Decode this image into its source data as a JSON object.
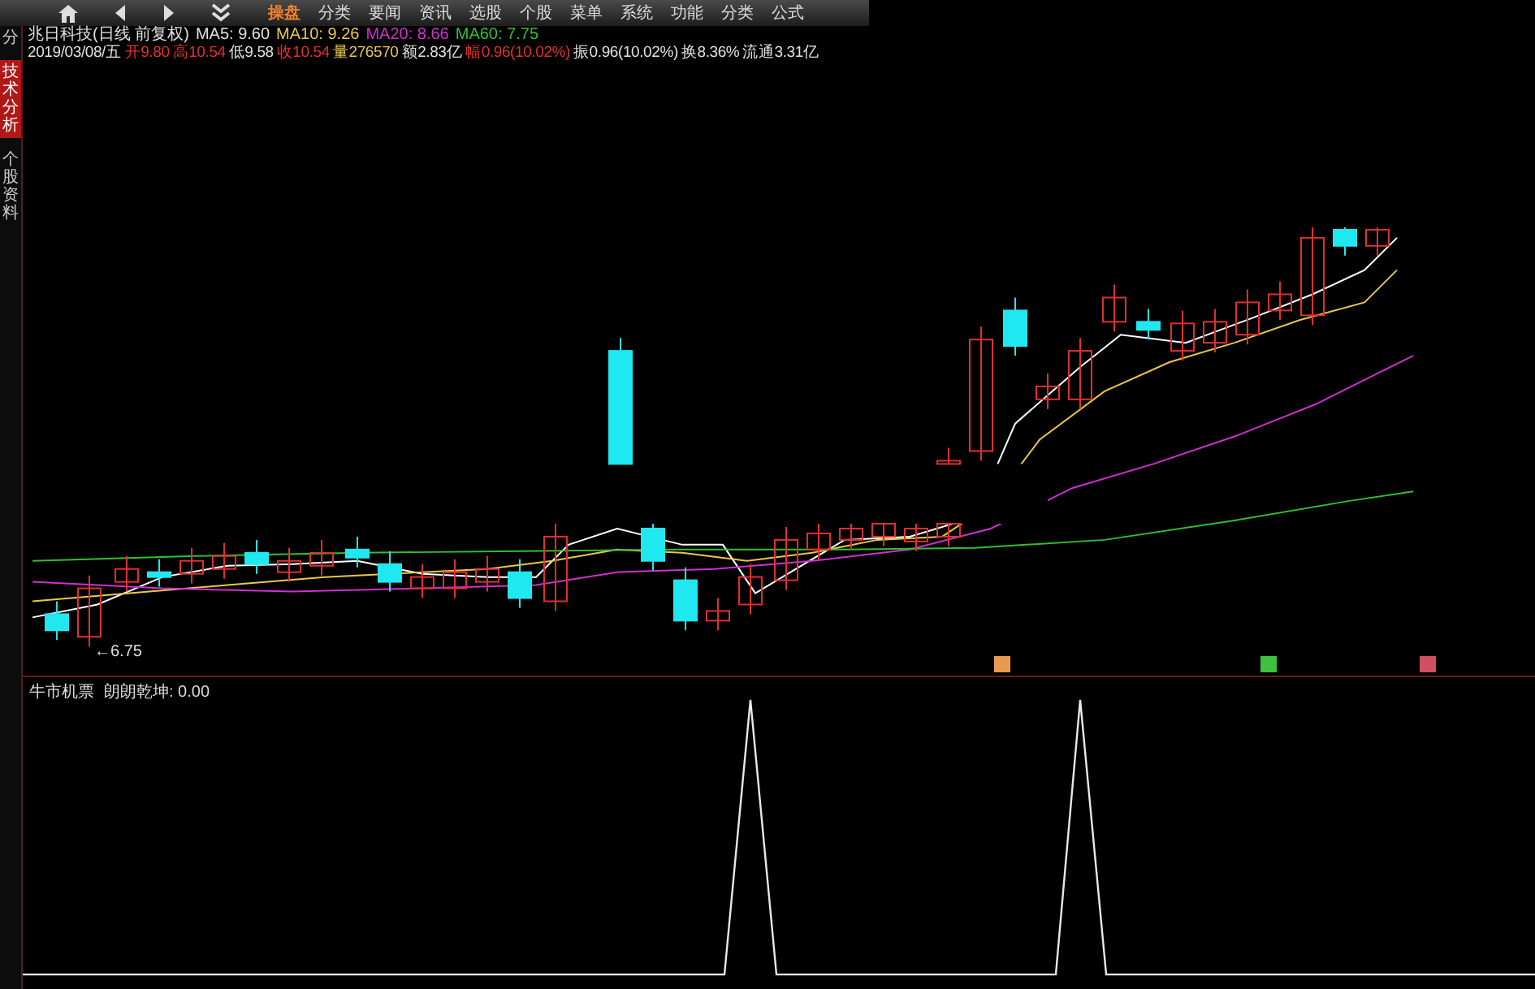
{
  "toolbar": {
    "tabs": [
      {
        "label": "操盘",
        "selected": true
      },
      {
        "label": "分类",
        "selected": false
      },
      {
        "label": "要闻",
        "selected": false
      },
      {
        "label": "资讯",
        "selected": false
      },
      {
        "label": "选股",
        "selected": false
      },
      {
        "label": "个股",
        "selected": false
      },
      {
        "label": "菜单",
        "selected": false
      },
      {
        "label": "系统",
        "selected": false
      },
      {
        "label": "功能",
        "selected": false
      },
      {
        "label": "分类",
        "selected": false
      },
      {
        "label": "公式",
        "selected": false
      }
    ]
  },
  "side_tabs": [
    {
      "label": "分",
      "selected": false
    },
    {
      "label": "技术分析",
      "selected": true
    },
    {
      "label": "个股资料",
      "selected": false
    }
  ],
  "info_line_1": [
    {
      "text": "兆日科技(日线 前复权)",
      "color": "#e0e0e0"
    },
    {
      "text": "MA5: 9.60",
      "color": "#e0e0e0"
    },
    {
      "text": "MA10: 9.26",
      "color": "#e8c84a"
    },
    {
      "text": "MA20: 8.66",
      "color": "#d030d0"
    },
    {
      "text": "MA60: 7.75",
      "color": "#30c030"
    }
  ],
  "info_line_2": [
    {
      "text": "2019/03/08/五",
      "color": "#e0e0e0"
    },
    {
      "text": "开9.80",
      "color": "#e03030"
    },
    {
      "text": "高10.54",
      "color": "#e03030"
    },
    {
      "text": "低9.58",
      "color": "#e0e0e0"
    },
    {
      "text": "收10.54",
      "color": "#e03030"
    },
    {
      "text": "量276570",
      "color": "#e8c84a"
    },
    {
      "text": "额2.83亿",
      "color": "#e0e0e0"
    },
    {
      "text": "幅0.96(10.02%)",
      "color": "#e03030"
    },
    {
      "text": "振0.96(10.02%)",
      "color": "#e0e0e0"
    },
    {
      "text": "换8.36%",
      "color": "#e0e0e0"
    },
    {
      "text": "流通3.31亿",
      "color": "#e0e0e0"
    }
  ],
  "low_label": "←6.75",
  "signals": [
    {
      "color": "#e89a50"
    },
    {
      "color": "#40c040"
    },
    {
      "color": "#d05060"
    }
  ],
  "indicator": {
    "name": "牛市机票",
    "reading": "朗朗乾坤: 0.00"
  }
}
